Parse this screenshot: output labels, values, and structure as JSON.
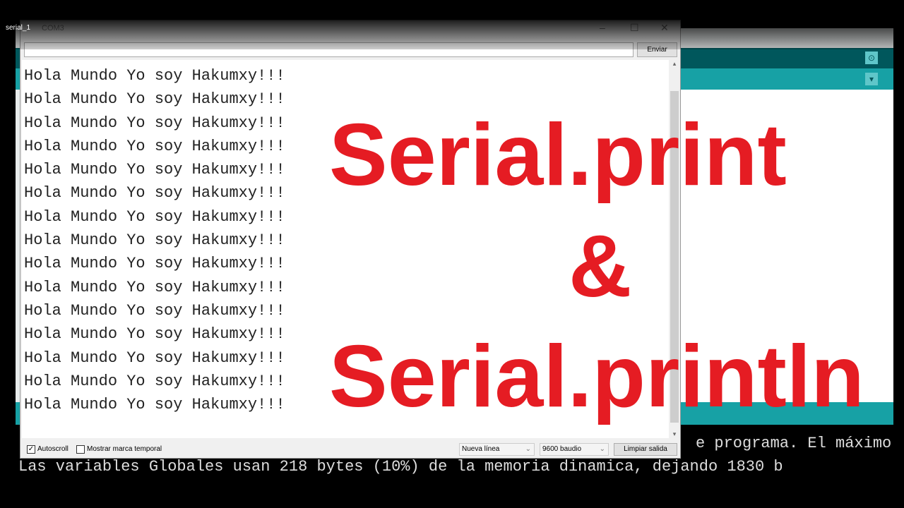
{
  "tab_name": "serial_1",
  "monitor": {
    "title": "COM3",
    "send_label": "Enviar",
    "input_value": "",
    "lines": [
      "Hola Mundo Yo soy Hakumxy!!!",
      "Hola Mundo Yo soy Hakumxy!!!",
      "Hola Mundo Yo soy Hakumxy!!!",
      "Hola Mundo Yo soy Hakumxy!!!",
      "Hola Mundo Yo soy Hakumxy!!!",
      "Hola Mundo Yo soy Hakumxy!!!",
      "Hola Mundo Yo soy Hakumxy!!!",
      "Hola Mundo Yo soy Hakumxy!!!",
      "Hola Mundo Yo soy Hakumxy!!!",
      "Hola Mundo Yo soy Hakumxy!!!",
      "Hola Mundo Yo soy Hakumxy!!!",
      "Hola Mundo Yo soy Hakumxy!!!",
      "Hola Mundo Yo soy Hakumxy!!!",
      "Hola Mundo Yo soy Hakumxy!!!",
      "Hola Mundo Yo soy Hakumxy!!!"
    ],
    "autoscroll_label": "Autoscroll",
    "autoscroll_checked": true,
    "timestamp_label": "Mostrar marca temporal",
    "timestamp_checked": false,
    "line_ending": "Nueva línea",
    "baud": "9600 baudio",
    "clear_label": "Limpiar salida"
  },
  "console": {
    "lines": [
      "                                              e programa. El máximo",
      "Las variables Globales usan 218 bytes (10%) de la memoria dinamica, dejando 1830 b"
    ]
  },
  "overlay": {
    "line1": "Serial.print",
    "line2": "&",
    "line3": "Serial.println",
    "color": "#e51c23"
  }
}
